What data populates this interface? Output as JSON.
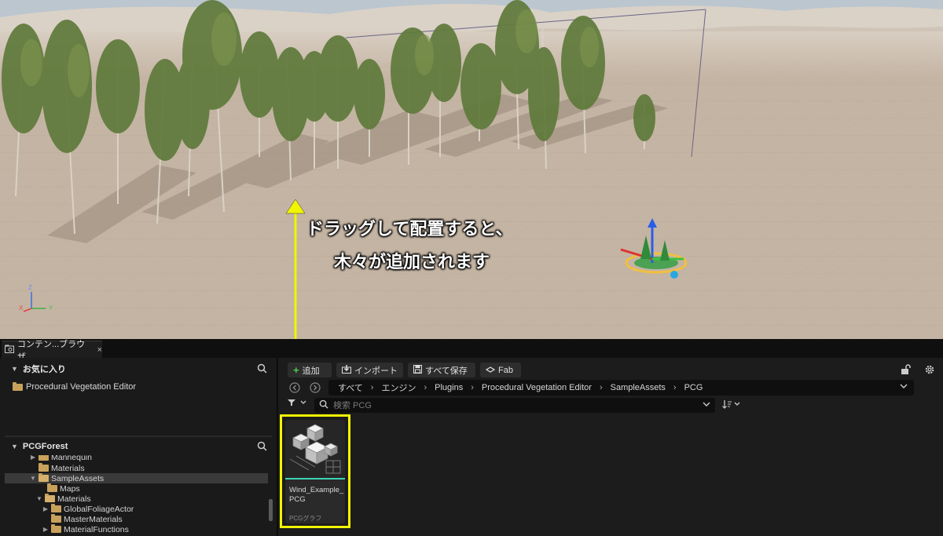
{
  "viewport": {
    "annotation_line1": "ドラッグして配置すると、",
    "annotation_line2": "木々が追加されます",
    "axis_labels": {
      "z": "Z",
      "x": "X",
      "y": "Y"
    }
  },
  "tab": {
    "label": "コンテン...ブラウザ",
    "close": "×"
  },
  "favorites": {
    "title": "お気に入り",
    "items": [
      "Procedural Vegetation Editor"
    ]
  },
  "project": {
    "title": "PCGForest",
    "tree": [
      {
        "label": "Mannequin",
        "state": "collapsed"
      },
      {
        "label": "Materials",
        "state": "leaf"
      },
      {
        "label": "SampleAssets",
        "state": "expanded",
        "selected": true
      },
      {
        "label": "Maps",
        "state": "leaf"
      },
      {
        "label": "Materials",
        "state": "expanded"
      },
      {
        "label": "GlobalFoliageActor",
        "state": "collapsed"
      },
      {
        "label": "MasterMaterials",
        "state": "leaf"
      },
      {
        "label": "MaterialFunctions",
        "state": "collapsed"
      }
    ]
  },
  "toolbar": {
    "add_label": "追加",
    "import_label": "インポート",
    "saveall_label": "すべて保存",
    "fab_label": "Fab"
  },
  "breadcrumb": [
    "すべて",
    "エンジン",
    "Plugins",
    "Procedural Vegetation Editor",
    "SampleAssets",
    "PCG"
  ],
  "search": {
    "placeholder": "検索 PCG"
  },
  "asset": {
    "name": "Wind_Example_PCG",
    "type": "PCGグラフ"
  },
  "colors": {
    "highlight": "#f2f500",
    "asset_bar": "#3fd3b5",
    "folder": "#c8a15a"
  }
}
